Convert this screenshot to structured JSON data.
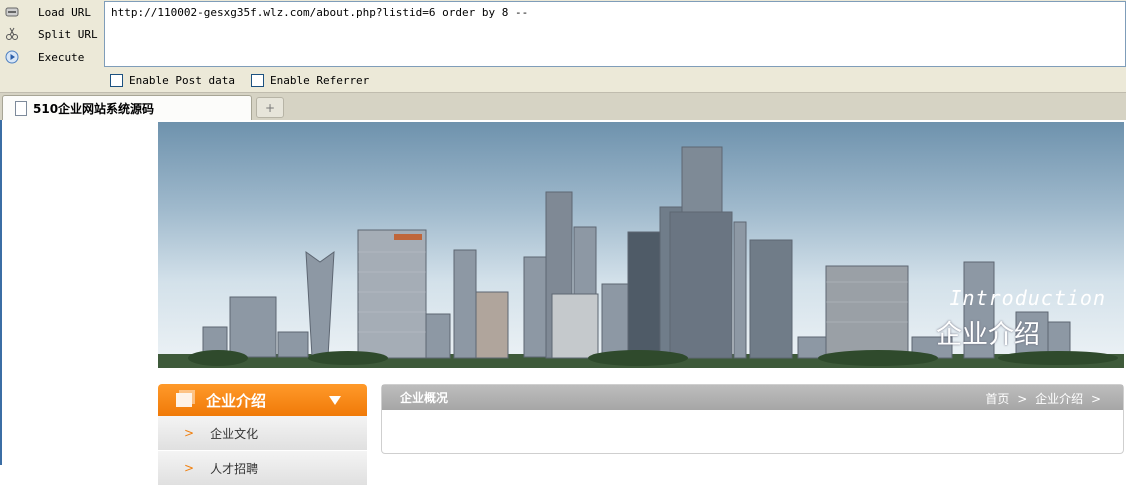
{
  "hackbar": {
    "load_label": "Load URL",
    "split_label": "Split URL",
    "execute_label": "Execute",
    "url": "http://110002-gesxg35f.wlz.com/about.php?listid=6 order by 8 --",
    "post_label": "Enable Post data",
    "referrer_label": "Enable Referrer"
  },
  "tabs": {
    "active_title": "510企业网站系统源码",
    "new_tab_symbol": "+"
  },
  "banner": {
    "en_text": "Introduction",
    "cn_text": "企业介绍"
  },
  "sidebar": {
    "title": "企业介绍",
    "items": [
      {
        "label": "企业文化"
      },
      {
        "label": "人才招聘"
      }
    ]
  },
  "content": {
    "title": "企业概况",
    "breadcrumb": {
      "home": "首页",
      "sep": ">",
      "current": "企业介绍"
    }
  }
}
